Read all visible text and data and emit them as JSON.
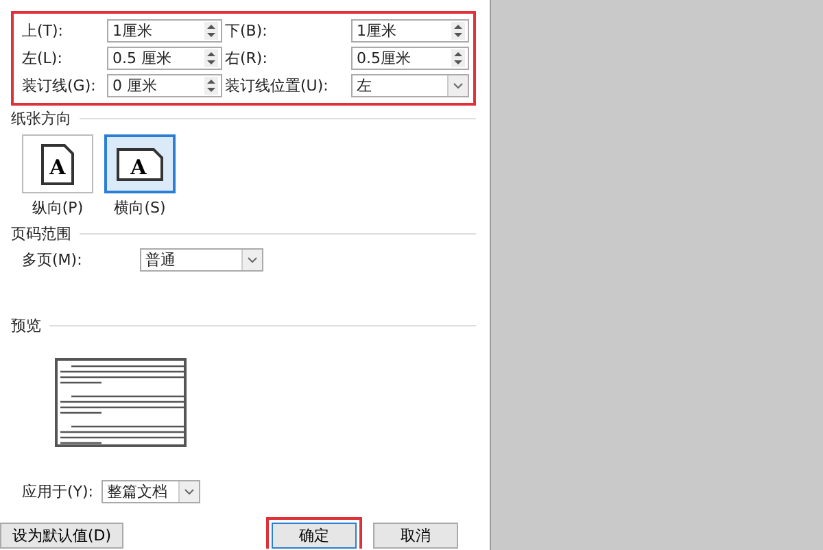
{
  "margins": {
    "highlighted": true,
    "fields": [
      {
        "label": "上(T):",
        "value": "1厘米",
        "kind": "spinner"
      },
      {
        "label": "下(B):",
        "value": "1厘米",
        "kind": "spinner"
      },
      {
        "label": "左(L):",
        "value": "0.5 厘米",
        "kind": "spinner"
      },
      {
        "label": "右(R):",
        "value": "0.5厘米",
        "kind": "spinner"
      },
      {
        "label": "装订线(G):",
        "value": "0 厘米",
        "kind": "spinner"
      },
      {
        "label": "装订线位置(U):",
        "value": "左",
        "kind": "select"
      }
    ]
  },
  "orientation": {
    "title": "纸张方向",
    "options": [
      {
        "label": "纵向(P)",
        "kind": "portrait",
        "glyph": "A",
        "selected": false
      },
      {
        "label": "横向(S)",
        "kind": "landscape",
        "glyph": "A",
        "selected": true
      }
    ]
  },
  "pages": {
    "title": "页码范围",
    "label": "多页(M):",
    "value": "普通"
  },
  "preview": {
    "title": "预览"
  },
  "apply_to": {
    "label": "应用于(Y):",
    "value": "整篇文档"
  },
  "buttons": [
    {
      "label": "设为默认值(D)",
      "kind": "default",
      "highlighted": false
    },
    {
      "label": "确定",
      "kind": "ok",
      "highlighted": true
    },
    {
      "label": "取消",
      "kind": "cancel",
      "highlighted": false
    }
  ]
}
